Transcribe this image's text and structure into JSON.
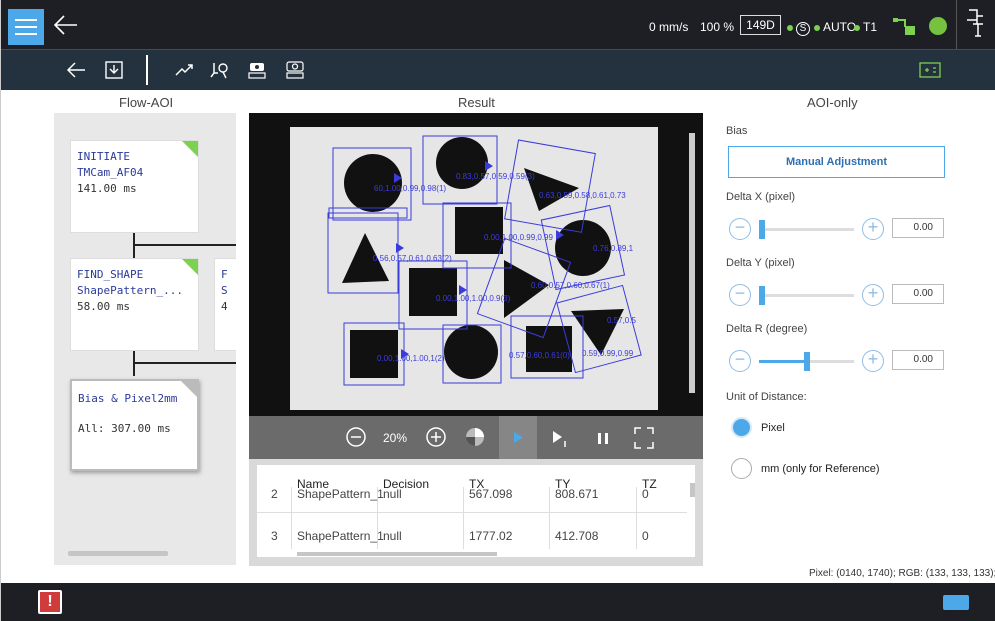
{
  "topbar": {
    "speed": "0 mm/s",
    "percent": "100 %",
    "speed_box": "149D",
    "mode_s": "S",
    "auto": "AUTO",
    "t1": "T1"
  },
  "panels": {
    "flow_title": "Flow-AOI",
    "result_title": "Result",
    "aoi_title": "AOI-only"
  },
  "flow": {
    "nodes": [
      {
        "name": "INITIATE",
        "sub": "TMCam_AF04",
        "time": "141.00 ms"
      },
      {
        "name": "FIND_SHAPE",
        "sub": "ShapePattern_...",
        "time": "58.00 ms"
      },
      {
        "name": "F",
        "sub": "S",
        "time": "4"
      },
      {
        "name": "Bias & Pixel2mm",
        "sub": "",
        "time": "All: 307.00 ms"
      }
    ]
  },
  "viewer": {
    "zoom": "20%",
    "labels": [
      "0.83,0.57,0.59,0.59(3)",
      "60,1.00,0.99,0.98(1)",
      "0.63,0.59,0.58,0.61,0.73",
      "0.00,1.00,0.99,0.99",
      "0.56,0.57,0.61,0.63(2)",
      "0.76,0.89,1",
      "0.00,1.00,1.00,0.9(3)",
      "0.60,0.57,0.60,0.67(1)",
      "0.57,0.5",
      "0.00,1.00,1.00,1(2)",
      "0.57,0.60,0.61(0)",
      "0.59,0.99,0.99"
    ]
  },
  "table": {
    "headers": [
      "Name",
      "Decision",
      "TX",
      "TY",
      "TZ"
    ],
    "rows": [
      [
        "2",
        "ShapePattern_1",
        "null",
        "567.098",
        "808.671",
        "0"
      ],
      [
        "3",
        "ShapePattern_1",
        "null",
        "1777.02",
        "412.708",
        "0"
      ]
    ]
  },
  "aoi": {
    "bias_label": "Bias",
    "manual_button": "Manual Adjustment",
    "delta_x_label": "Delta X (pixel)",
    "delta_x_value": "0.00",
    "delta_y_label": "Delta Y (pixel)",
    "delta_y_value": "0.00",
    "delta_r_label": "Delta R (degree)",
    "delta_r_value": "0.00",
    "delta_r_fraction": 0.5,
    "unit_label": "Unit of Distance:",
    "unit_pixel": "Pixel",
    "unit_mm": "mm (only for Reference)"
  },
  "footer": {
    "pixel_info": "Pixel: (0140, 1740); RGB: (133, 133, 133);"
  },
  "colors": {
    "accent": "#4ca8e8",
    "topbar_bg": "#1d1f24",
    "toolbar_bg": "#24313e",
    "status_green": "#7cd151"
  }
}
